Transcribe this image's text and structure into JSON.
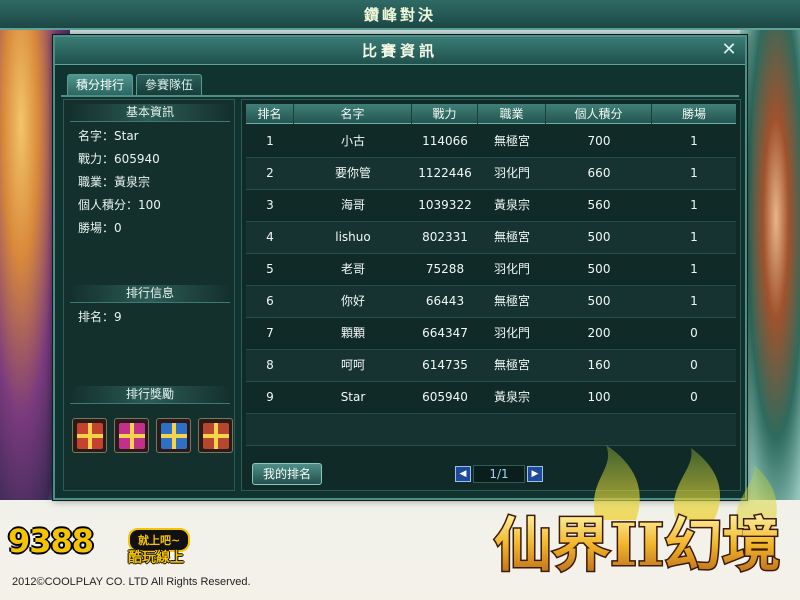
{
  "top_title": "鑽峰對決",
  "dialog": {
    "title": "比賽資訊",
    "close_label": "✕"
  },
  "tabs": [
    {
      "label": "積分排行",
      "active": true
    },
    {
      "label": "參賽隊伍",
      "active": false
    }
  ],
  "basic_info": {
    "header": "基本資訊",
    "name": "名字：Star",
    "power": "戰力：605940",
    "profession": "職業：黃泉宗",
    "score": "個人積分：100",
    "wins": "勝場：0"
  },
  "rank_info": {
    "header": "排行信息",
    "rank": "排名：9"
  },
  "rewards": {
    "header": "排行獎勵",
    "items": [
      "gift-box-icon",
      "gift-box-icon",
      "gift-box-icon",
      "gift-box-icon"
    ]
  },
  "table": {
    "headers": [
      "排名",
      "名字",
      "戰力",
      "職業",
      "個人積分",
      "勝場"
    ],
    "rows": [
      [
        "1",
        "小古",
        "114066",
        "無極宮",
        "700",
        "1"
      ],
      [
        "2",
        "要你管",
        "1122446",
        "羽化門",
        "660",
        "1"
      ],
      [
        "3",
        "海哥",
        "1039322",
        "黃泉宗",
        "560",
        "1"
      ],
      [
        "4",
        "lishuo",
        "802331",
        "無極宮",
        "500",
        "1"
      ],
      [
        "5",
        "老哥",
        "75288",
        "羽化門",
        "500",
        "1"
      ],
      [
        "6",
        "你好",
        "66443",
        "無極宮",
        "500",
        "1"
      ],
      [
        "7",
        "顆顆",
        "664347",
        "羽化門",
        "200",
        "0"
      ],
      [
        "8",
        "呵呵",
        "614735",
        "無極宮",
        "160",
        "0"
      ],
      [
        "9",
        "Star",
        "605940",
        "黃泉宗",
        "100",
        "0"
      ]
    ]
  },
  "my_rank_button": "我的排名",
  "pager": {
    "prev": "◀",
    "page": "1/1",
    "next": "▶"
  },
  "footer": {
    "logo": "9388",
    "tag": "就上吧~",
    "sub": "酷玩線上",
    "copyright": "2012©COOLPLAY CO. LTD All Rights Reserved.",
    "game_logo": "仙界II幻境"
  },
  "colors": {
    "panel_bg": "#103330",
    "accent_border": "#4f8e86",
    "text": "#f2f8f5",
    "gold": "#f5c400"
  }
}
